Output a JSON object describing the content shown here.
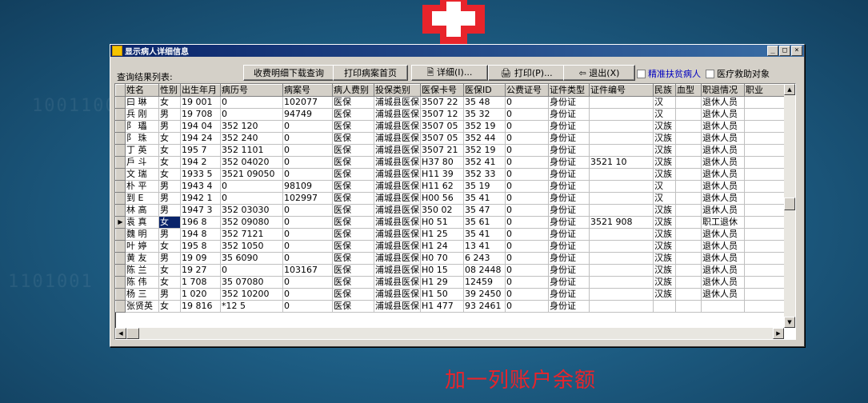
{
  "window": {
    "title": "显示病人详细信息",
    "controls": [
      "_",
      "□",
      "×"
    ]
  },
  "toolbar": {
    "result_label": "查询结果列表:",
    "download_label": "收费明细下载查询",
    "print_first_label": "打印病案首页",
    "detail_label": "🗎 详细(I)...",
    "print_label": "🖨 打印(P)...",
    "exit_label": "⇦ 退出(X)",
    "chk_poverty_label": "精准扶贫病人",
    "chk_medical_aid_label": "医疗救助对象"
  },
  "table": {
    "columns": [
      "姓名",
      "性别",
      "出生年月",
      "病历号",
      "病案号",
      "病人费别",
      "投保类别",
      "医保卡号",
      "医保ID",
      "公费证号",
      "证件类型",
      "证件编号",
      "民族",
      "血型",
      "职退情况",
      "职业"
    ],
    "rows": [
      [
        "曰 琳",
        "女",
        "19 001",
        "0",
        "102077",
        "医保",
        "浦城县医保",
        "3507 22",
        "35 48",
        "0",
        "身份证",
        "",
        "汉",
        "",
        "退休人员",
        ""
      ],
      [
        "兵 刚",
        "男",
        "19 708",
        "0",
        "94749",
        "医保",
        "浦城县医保",
        "3507 12",
        "35 32",
        "0",
        "身份证",
        "",
        "汉",
        "",
        "退休人员",
        ""
      ],
      [
        "阝 瓃",
        "男",
        "194 04",
        "352 120",
        "0",
        "医保",
        "浦城县医保",
        "3507 05",
        "352 19",
        "0",
        "身份证",
        "",
        "汉族",
        "",
        "退休人员",
        ""
      ],
      [
        "阝 珠",
        "女",
        "194 24",
        "352 240",
        "0",
        "医保",
        "浦城县医保",
        "3507 05",
        "352 44",
        "0",
        "身份证",
        "",
        "汉族",
        "",
        "退休人员",
        ""
      ],
      [
        "丁 英",
        "女",
        "195 7",
        "352 1101",
        "0",
        "医保",
        "浦城县医保",
        "3507 21",
        "352 19",
        "0",
        "身份证",
        "",
        "汉族",
        "",
        "退休人员",
        ""
      ],
      [
        "戶 斗",
        "女",
        "194 2",
        "352 04020",
        "0",
        "医保",
        "浦城县医保",
        "H37 80",
        "352 41",
        "0",
        "身份证",
        "3521 10",
        "汉族",
        "",
        "退休人员",
        ""
      ],
      [
        "文 瑞",
        "女",
        "1933 5",
        "3521 09050",
        "0",
        "医保",
        "浦城县医保",
        "H11 39",
        "352 33",
        "0",
        "身份证",
        "",
        "汉族",
        "",
        "退休人员",
        ""
      ],
      [
        "朴 平",
        "男",
        "1943 4",
        "0",
        "98109",
        "医保",
        "浦城县医保",
        "H11 62",
        "35 19",
        "0",
        "身份证",
        "",
        "汉",
        "",
        "退休人员",
        ""
      ],
      [
        "到 E",
        "男",
        "1942 1",
        "0",
        "102997",
        "医保",
        "浦城县医保",
        "H00 56",
        "35 41",
        "0",
        "身份证",
        "",
        "汉",
        "",
        "退休人员",
        ""
      ],
      [
        "林 高",
        "男",
        "1947 3",
        "352 03030",
        "0",
        "医保",
        "浦城县医保",
        "350 02",
        "35 47",
        "0",
        "身份证",
        "",
        "汉族",
        "",
        "退休人员",
        ""
      ],
      [
        "袁 真",
        "女",
        "196 8",
        "352 09080",
        "0",
        "医保",
        "浦城县医保",
        "H0 51",
        "35 61",
        "0",
        "身份证",
        "3521 908",
        "汉族",
        "",
        "职工退休",
        ""
      ],
      [
        "魏 明",
        "男",
        "194 8",
        "352 7121",
        "0",
        "医保",
        "浦城县医保",
        "H1 25",
        "35 41",
        "0",
        "身份证",
        "",
        "汉族",
        "",
        "退休人员",
        ""
      ],
      [
        "叶 婷",
        "女",
        "195 8",
        "352 1050",
        "0",
        "医保",
        "浦城县医保",
        "H1 24",
        "13 41",
        "0",
        "身份证",
        "",
        "汉族",
        "",
        "退休人员",
        ""
      ],
      [
        "黄 友",
        "男",
        "19 09",
        "35 6090",
        "0",
        "医保",
        "浦城县医保",
        "H0 70",
        "6 243",
        "0",
        "身份证",
        "",
        "汉族",
        "",
        "退休人员",
        ""
      ],
      [
        "陈 兰",
        "女",
        "19 27",
        "0",
        "103167",
        "医保",
        "浦城县医保",
        "H0 15",
        "08 2448",
        "0",
        "身份证",
        "",
        "汉族",
        "",
        "退休人员",
        ""
      ],
      [
        "陈 伟",
        "女",
        "1 708",
        "35 07080",
        "0",
        "医保",
        "浦城县医保",
        "H1 29",
        "12459",
        "0",
        "身份证",
        "",
        "汉族",
        "",
        "退休人员",
        ""
      ],
      [
        "杨 三",
        "男",
        "1 020",
        "352 10200",
        "0",
        "医保",
        "浦城县医保",
        "H1 50",
        "39 2450",
        "0",
        "身份证",
        "",
        "汉族",
        "",
        "退休人员",
        ""
      ],
      [
        "张贤英",
        "女",
        "19 816",
        "*12 5",
        "0",
        "医保",
        "浦城县医保",
        "H1 477",
        "93 2461",
        "0",
        "身份证",
        "",
        "",
        "",
        "",
        ""
      ]
    ],
    "selected_row": 10
  },
  "annotation": "加一列账户余额"
}
